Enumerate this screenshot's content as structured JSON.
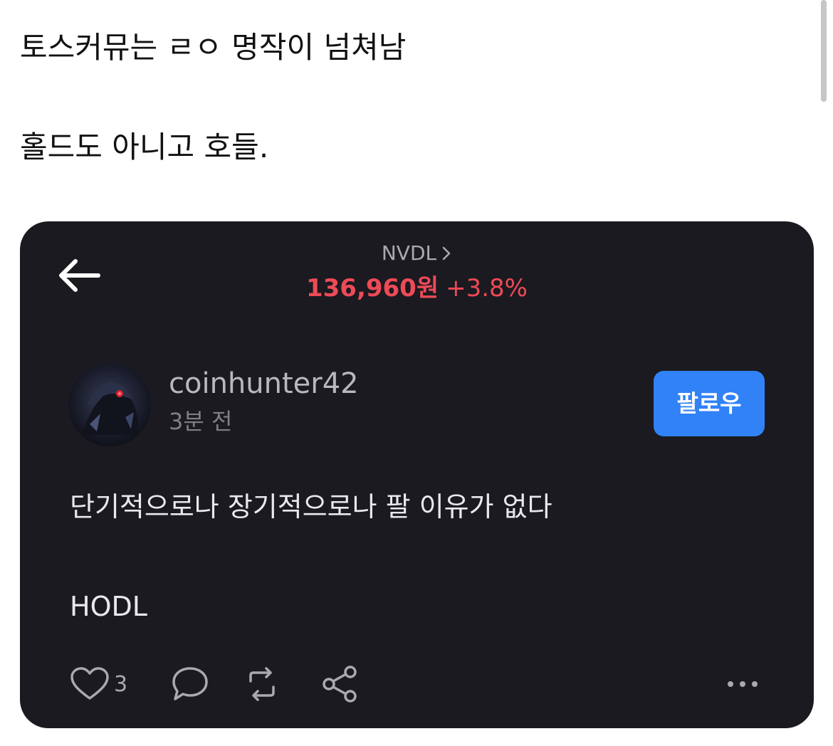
{
  "caption": {
    "line1": "토스커뮤는 ㄹㅇ 명작이 넘쳐남",
    "line2": "홀드도 아니고 호들."
  },
  "stock": {
    "ticker": "NVDL",
    "price": "136,960원",
    "change": "+3.8%"
  },
  "post": {
    "username": "coinhunter42",
    "time_ago": "3분 전",
    "follow_label": "팔로우",
    "body_line1": "단기적으로나 장기적으로나 팔 이유가 없다",
    "body_line2": "HODL",
    "like_count": "3"
  },
  "icons": {
    "back": "arrow-left-icon",
    "ticker_chevron": "chevron-right-icon",
    "like": "heart-icon",
    "comment": "comment-bubble-icon",
    "repost": "repost-icon",
    "share": "share-icon",
    "more": "more-dots-icon"
  },
  "colors": {
    "card_bg": "#1b1a20",
    "price_up": "#ee4a57",
    "follow_button": "#3182f6"
  }
}
